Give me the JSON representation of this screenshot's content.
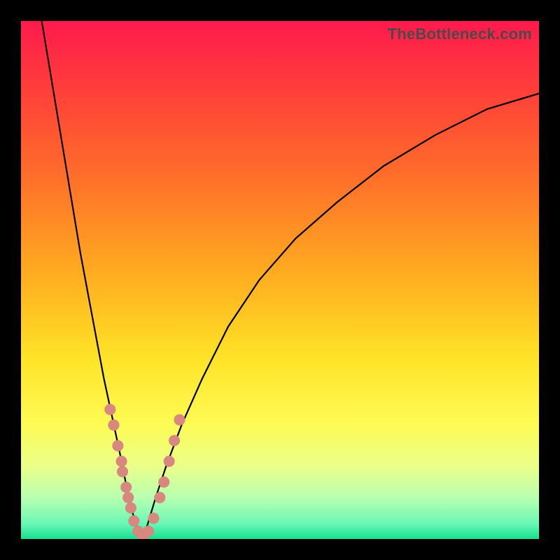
{
  "watermark": "TheBottleneck.com",
  "chart_data": {
    "type": "line",
    "title": "",
    "xlabel": "",
    "ylabel": "",
    "xlim": [
      0,
      100
    ],
    "ylim": [
      0,
      100
    ],
    "background_gradient": {
      "stops": [
        {
          "pct": 0,
          "color": "#ff1a4d"
        },
        {
          "pct": 12,
          "color": "#ff3b3b"
        },
        {
          "pct": 30,
          "color": "#ff6e2a"
        },
        {
          "pct": 50,
          "color": "#ffb01f"
        },
        {
          "pct": 65,
          "color": "#ffe327"
        },
        {
          "pct": 78,
          "color": "#fdfb55"
        },
        {
          "pct": 86,
          "color": "#eaff8a"
        },
        {
          "pct": 92,
          "color": "#b9ffb0"
        },
        {
          "pct": 97,
          "color": "#6cf7b5"
        },
        {
          "pct": 100,
          "color": "#16e08f"
        }
      ]
    },
    "series": [
      {
        "name": "left-branch",
        "x": [
          4.0,
          5.5,
          7.0,
          8.5,
          10.0,
          11.5,
          13.0,
          14.5,
          16.0,
          17.5,
          19.0,
          20.2,
          21.3,
          22.4,
          23.5
        ],
        "y": [
          100,
          91,
          82,
          73,
          64,
          55,
          47,
          39,
          31,
          24,
          17,
          11,
          6,
          2,
          0
        ],
        "style": {
          "stroke": "#000000",
          "width": 2
        }
      },
      {
        "name": "right-branch",
        "x": [
          23.5,
          24.5,
          26.0,
          28.0,
          31.0,
          35.0,
          40.0,
          46.0,
          53.0,
          61.0,
          70.0,
          80.0,
          90.0,
          100.0
        ],
        "y": [
          0,
          3,
          8,
          14,
          22,
          31,
          41,
          50,
          58,
          65,
          72,
          78,
          83,
          86
        ],
        "style": {
          "stroke": "#000000",
          "width": 2
        }
      }
    ],
    "highlight_points": {
      "comment": "salmon dots clustered near valley bottom",
      "color": "#d98880",
      "radius": 8,
      "points": [
        {
          "x": 17.2,
          "y": 25
        },
        {
          "x": 17.9,
          "y": 22
        },
        {
          "x": 18.7,
          "y": 18
        },
        {
          "x": 19.4,
          "y": 15
        },
        {
          "x": 19.6,
          "y": 13
        },
        {
          "x": 20.3,
          "y": 10
        },
        {
          "x": 20.7,
          "y": 8
        },
        {
          "x": 21.2,
          "y": 6
        },
        {
          "x": 21.8,
          "y": 3.5
        },
        {
          "x": 22.6,
          "y": 1.5
        },
        {
          "x": 23.5,
          "y": 0.5
        },
        {
          "x": 24.6,
          "y": 1.5
        },
        {
          "x": 25.6,
          "y": 4
        },
        {
          "x": 26.8,
          "y": 8
        },
        {
          "x": 27.6,
          "y": 11
        },
        {
          "x": 28.6,
          "y": 15
        },
        {
          "x": 29.6,
          "y": 19
        },
        {
          "x": 30.6,
          "y": 23
        }
      ]
    }
  }
}
